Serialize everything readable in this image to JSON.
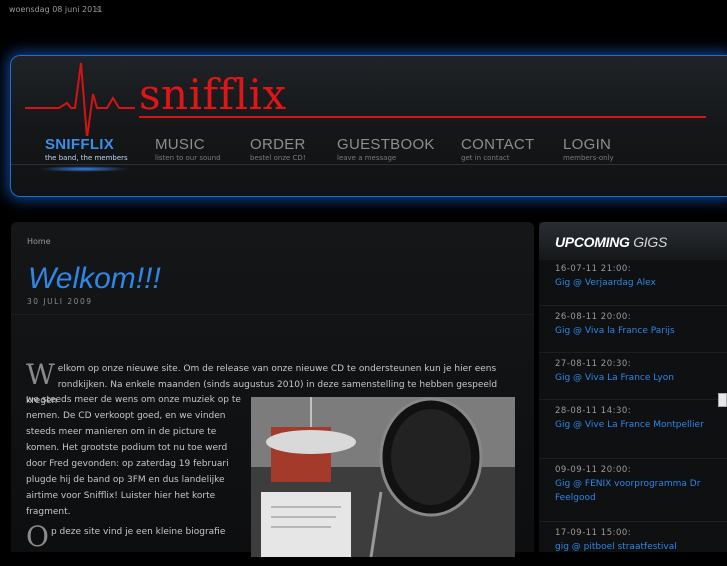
{
  "topbar": {
    "date": "woensdag 08 juni 2011",
    "sep": "s"
  },
  "logo": {
    "text": "snifflix",
    "color": "#e01515"
  },
  "nav": [
    {
      "title": "SNIFFLIX",
      "sub": "the band, the members",
      "active": true
    },
    {
      "title": "MUSIC",
      "sub": "listen to our sound"
    },
    {
      "title": "ORDER",
      "sub": "bestel onze CD!"
    },
    {
      "title": "GUESTBOOK",
      "sub": "leave a message"
    },
    {
      "title": "CONTACT",
      "sub": "get in contact"
    },
    {
      "title": "LOGIN",
      "sub": "members-only"
    }
  ],
  "main": {
    "breadcrumb": "Home",
    "title": "Welkom!!!",
    "date": "30 JULI 2009",
    "p1_cap": "W",
    "p1": "elkom op onze nieuwe site. Om de release van onze nieuwe CD te ondersteunen kun je hier eens rondkijken. Na enkele maanden (sinds augustus 2010) in deze samenstelling te hebben gespeeld kregen",
    "p2": "we steeds meer de wens om onze muziek op te nemen. De CD verkoopt goed, en we vinden steeds meer manieren om in de picture te komen. Het grootste podium tot nu toe werd door Fred gevonden: op zaterdag 19 februari plugde hij de band op 3FM en dus landelijke airtime voor Snifflix! Luister hier het korte fragment.",
    "p3_cap": "O",
    "p3": "p deze site vind je een kleine biografie"
  },
  "sidebar": {
    "title_bold": "UPCOMING",
    "title_rest": "GIGS",
    "gigs": [
      {
        "date": "16-07-11 21:00:",
        "name": "Gig @ Verjaardag Alex"
      },
      {
        "date": "26-08-11 20:00:",
        "name": "Gig @ Viva la France Parijs"
      },
      {
        "date": "27-08-11 20:30:",
        "name": "Gig @ Viva La France Lyon"
      },
      {
        "date": "28-08-11 14:30:",
        "name": "Gig @ Vive La France Montpellier"
      },
      {
        "date": "09-09-11 20:00:",
        "name": "Gig @ FENIX voorprogramma Dr Feelgood"
      },
      {
        "date": "17-09-11 15:00:",
        "name": "gig @ pitboel straatfestival"
      }
    ]
  },
  "accent": "#2f86e6"
}
